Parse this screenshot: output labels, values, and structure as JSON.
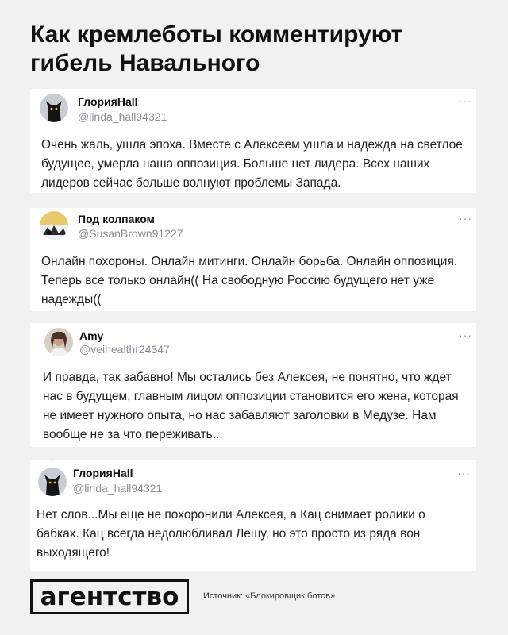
{
  "title": "Как кремлеботы комментируют гибель Навального",
  "tweets": [
    {
      "name": "ГлорияHall",
      "handle": "@linda_hall94321",
      "more": "···",
      "text": "Очень жаль, ушла эпоха. Вместе с Алексеем ушла и надежда на светлое будущее, умерла наша оппозиция. Больше нет лидера. Всех наших лидеров сейчас больше волнуют проблемы Запада.",
      "avatar": "black-cat-avatar-icon"
    },
    {
      "name": "Под колпаком",
      "handle": "@SusanBrown91227",
      "more": "···",
      "text": "Онлайн похороны. Онлайн митинги. Онлайн борьба. Онлайн оппозиция. Теперь все только онлайн(( На свободную Россию будущего нет уже надежды((",
      "avatar": "landscape-avatar-icon"
    },
    {
      "name": "Amy",
      "handle": "@veihealthr24347",
      "more": "···",
      "text": "И правда, так забавно! Мы остались без Алексея, не понятно, что ждет нас в будущем, главным лицом оппозиции становится его жена, которая не имеет нужного опыта, но нас забавляют заголовки в Медузе. Нам вообще не за что переживать...",
      "avatar": "woman-avatar-icon"
    },
    {
      "name": "ГлорияHall",
      "handle": "@linda_hall94321",
      "more": "···",
      "text": "Нет слов...Мы еще не похоронили Алексея, а Кац снимает ролики о бабках. Кац всегда недолюбливал Лешу, но это просто из ряда вон выходящего!",
      "avatar": "black-cat-avatar-icon"
    }
  ],
  "logo": "агентство",
  "source": "Источник: «Блокировщик ботов»"
}
